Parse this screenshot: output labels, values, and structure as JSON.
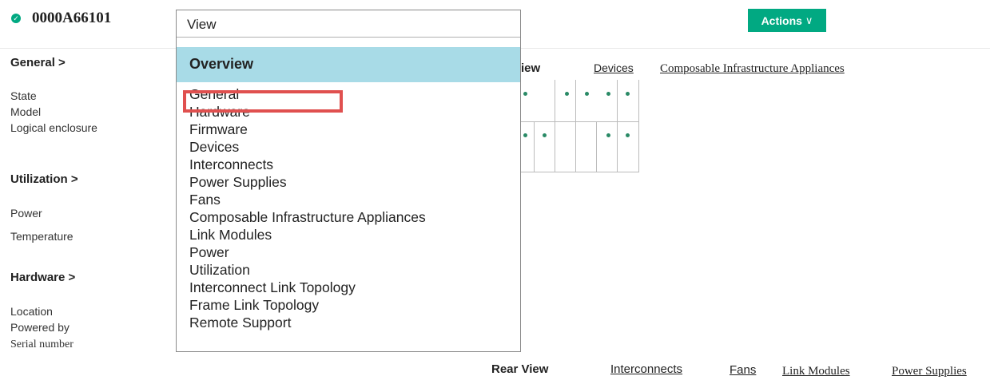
{
  "header": {
    "title": "0000A66101",
    "status_icon": "check-circle-icon",
    "status_color": "#01a982",
    "actions_label": "Actions",
    "actions_chevron": "∨"
  },
  "left_panel": {
    "general": {
      "heading": "General >",
      "fields": [
        "State",
        "Model",
        "Logical enclosure"
      ]
    },
    "utilization": {
      "heading": "Utilization >",
      "fields": [
        "Power",
        "Temperature"
      ]
    },
    "hardware": {
      "heading": "Hardware >",
      "fields": [
        "Location",
        "Powered by",
        "Serial number"
      ]
    }
  },
  "front_row": {
    "view_label": "Front View",
    "visible_view_label": "iew",
    "links": [
      "Devices",
      "Composable Infrastructure Appliances"
    ]
  },
  "rear_row": {
    "view_label": "Rear View",
    "links": [
      "Interconnects",
      "Fans",
      "Link Modules",
      "Power Supplies"
    ]
  },
  "dropdown": {
    "select_label": "View",
    "selected": "Overview",
    "options": [
      "General",
      "Hardware",
      "Firmware",
      "Devices",
      "Interconnects",
      "Power Supplies",
      "Fans",
      "Composable Infrastructure Appliances",
      "Link Modules",
      "Power",
      "Utilization",
      "Interconnect Link Topology",
      "Frame Link Topology",
      "Remote Support"
    ],
    "highlighted_option": "Hardware",
    "highlight_color": "#e0504f",
    "selected_bg": "#a8dbe7"
  },
  "colors": {
    "accent": "#01a982"
  }
}
